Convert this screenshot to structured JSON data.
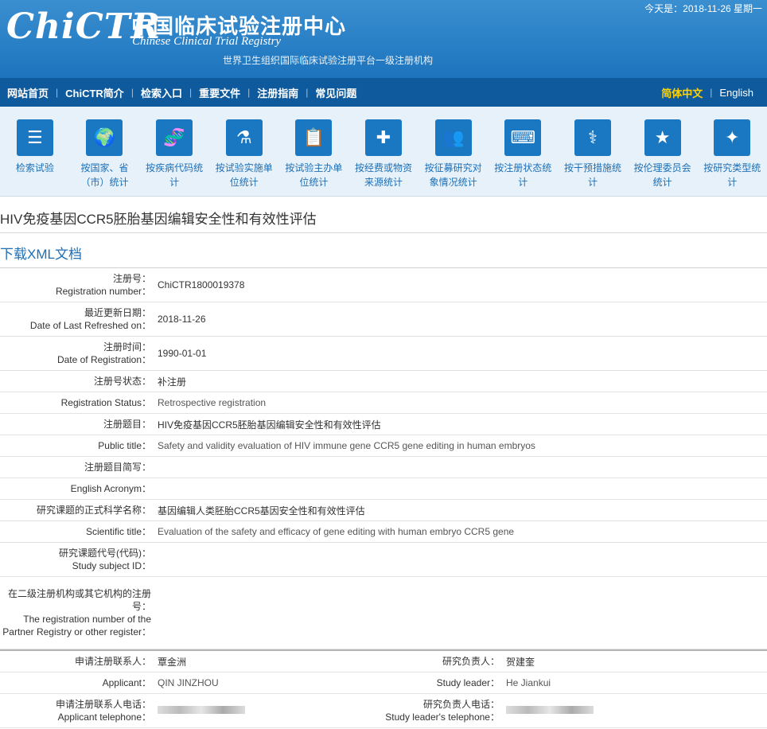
{
  "header": {
    "logo": "ChiCTR",
    "site_cn": "中国临床试验注册中心",
    "site_en": "Chinese Clinical Trial Registry",
    "subtitle": "世界卫生组织国际临床试验注册平台一级注册机构",
    "today": "今天是：2018-11-26 星期一"
  },
  "nav": {
    "items": [
      "网站首页",
      "ChiCTR简介",
      "检索入口",
      "重要文件",
      "注册指南",
      "常见问题"
    ],
    "lang_current": "简体中文",
    "lang_other": "English"
  },
  "icons": [
    {
      "label": "检索试验",
      "icon": "list-icon"
    },
    {
      "label": "按国家、省（市）统计",
      "icon": "map-icon"
    },
    {
      "label": "按疾病代码统计",
      "icon": "dna-icon"
    },
    {
      "label": "按试验实施单位统计",
      "icon": "flask-icon"
    },
    {
      "label": "按试验主办单位统计",
      "icon": "clipboard-icon"
    },
    {
      "label": "按经费或物资来源统计",
      "icon": "medkit-icon"
    },
    {
      "label": "按征募研究对象情况统计",
      "icon": "people-icon"
    },
    {
      "label": "按注册状态统计",
      "icon": "computer-icon"
    },
    {
      "label": "按干预措施统计",
      "icon": "doctor-icon"
    },
    {
      "label": "按伦理委员会统计",
      "icon": "star-icon"
    },
    {
      "label": "按研究类型统计",
      "icon": "sparkle-icon"
    }
  ],
  "page_title": "HIV免疫基因CCR5胚胎基因编辑安全性和有效性评估",
  "download_xml": "下载XML文档",
  "rows": [
    {
      "label_cn": "注册号：",
      "label_en": "Registration number：",
      "value": "ChiCTR1800019378"
    },
    {
      "label_cn": "最近更新日期：",
      "label_en": "Date of Last Refreshed on：",
      "value": "2018-11-26"
    },
    {
      "label_cn": "注册时间：",
      "label_en": "Date of Registration：",
      "value": "1990-01-01"
    },
    {
      "label": "注册号状态：",
      "value": "补注册"
    },
    {
      "label": "Registration Status：",
      "value": "Retrospective registration",
      "en": true
    },
    {
      "label": "注册题目：",
      "value": "HIV免疫基因CCR5胚胎基因编辑安全性和有效性评估"
    },
    {
      "label": "Public title：",
      "value": "Safety and validity evaluation of HIV immune gene CCR5 gene editing in human embryos",
      "en": true
    },
    {
      "label": "注册题目简写：",
      "value": ""
    },
    {
      "label": "English Acronym：",
      "value": ""
    },
    {
      "label": "研究课题的正式科学名称：",
      "value": "基因编辑人类胚胎CCR5基因安全性和有效性评估"
    },
    {
      "label": "Scientific title：",
      "value": "Evaluation of the safety and efficacy of gene editing with human embryo CCR5 gene",
      "en": true
    },
    {
      "label_cn": "研究课题代号(代码)：",
      "label_en": "Study subject ID：",
      "value": ""
    }
  ],
  "partner_label_cn": "在二级注册机构或其它机构的注册号：",
  "partner_label_en": "The registration number of the Partner Registry or other register：",
  "contacts": {
    "applicant_cn_label": "申请注册联系人：",
    "applicant_cn": "覃金洲",
    "leader_cn_label": "研究负责人：",
    "leader_cn": "贺建奎",
    "applicant_en_label": "Applicant：",
    "applicant_en": "QIN JINZHOU",
    "leader_en_label": "Study leader：",
    "leader_en": "He Jiankui",
    "applicant_tel_cn": "申请注册联系人电话：",
    "applicant_tel_en": "Applicant telephone：",
    "leader_tel_cn": "研究负责人电话：",
    "leader_tel_en": "Study leader's telephone："
  }
}
